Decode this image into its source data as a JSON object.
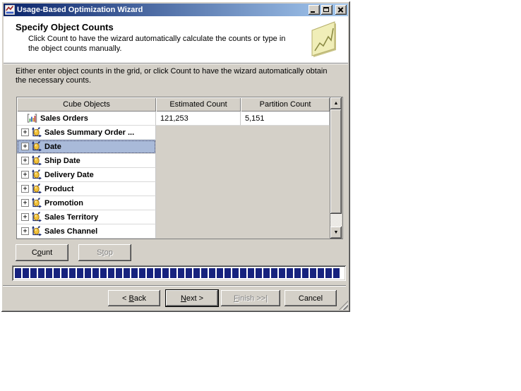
{
  "window": {
    "title": "Usage-Based Optimization Wizard",
    "icons": {
      "app": "chart-wizard-icon",
      "minimize": "minimize-icon",
      "maximize": "maximize-icon",
      "close": "close-icon"
    }
  },
  "header": {
    "title": "Specify Object Counts",
    "description": "Click Count to have the wizard automatically calculate the counts or type in the object counts manually.",
    "icon": "line-chart-icon"
  },
  "instruction": "Either enter object counts in the grid, or click Count to have the wizard automatically obtain the necessary counts.",
  "grid": {
    "columns": [
      "Cube Objects",
      "Estimated Count",
      "Partition Count"
    ],
    "expand_glyph": "+",
    "scroll_up_glyph": "▲",
    "scroll_down_glyph": "▼",
    "rows": [
      {
        "label": "Sales Orders",
        "icon": "measure-group",
        "estimated_count": "121,253",
        "partition_count": "5,151",
        "expandable": false,
        "selected": false
      },
      {
        "label": "Sales Summary Order ...",
        "icon": "dimension",
        "estimated_count": "",
        "partition_count": "",
        "expandable": true,
        "selected": false
      },
      {
        "label": "Date",
        "icon": "dimension",
        "estimated_count": "",
        "partition_count": "",
        "expandable": true,
        "selected": true
      },
      {
        "label": "Ship Date",
        "icon": "dimension",
        "estimated_count": "",
        "partition_count": "",
        "expandable": true,
        "selected": false
      },
      {
        "label": "Delivery Date",
        "icon": "dimension",
        "estimated_count": "",
        "partition_count": "",
        "expandable": true,
        "selected": false
      },
      {
        "label": "Product",
        "icon": "dimension",
        "estimated_count": "",
        "partition_count": "",
        "expandable": true,
        "selected": false
      },
      {
        "label": "Promotion",
        "icon": "dimension",
        "estimated_count": "",
        "partition_count": "",
        "expandable": true,
        "selected": false
      },
      {
        "label": "Sales Territory",
        "icon": "dimension",
        "estimated_count": "",
        "partition_count": "",
        "expandable": true,
        "selected": false
      },
      {
        "label": "Sales Channel",
        "icon": "dimension",
        "estimated_count": "",
        "partition_count": "",
        "expandable": true,
        "selected": false
      }
    ]
  },
  "actions": {
    "count": {
      "pre": "C",
      "key": "o",
      "post": "unt",
      "enabled": true
    },
    "stop": {
      "pre": "S",
      "key": "t",
      "post": "op",
      "enabled": false
    }
  },
  "progress": {
    "percent": 100,
    "block_color": "#16227e"
  },
  "nav": {
    "back": {
      "pre": "< ",
      "key": "B",
      "post": "ack",
      "enabled": true,
      "default": false
    },
    "next": {
      "pre": "",
      "key": "N",
      "post": "ext >",
      "enabled": true,
      "default": true
    },
    "finish": {
      "pre": "",
      "key": "F",
      "post": "inish >>|",
      "enabled": false,
      "default": false
    },
    "cancel": {
      "pre": "",
      "key": "",
      "post": "Cancel",
      "enabled": true,
      "default": false
    }
  },
  "colors": {
    "titlebar_gradient_start": "#0a246a",
    "titlebar_gradient_end": "#a6caf0",
    "dialog_face": "#d4d0c8",
    "selection_fill": "#a9bad9",
    "progress_block": "#16227e"
  }
}
